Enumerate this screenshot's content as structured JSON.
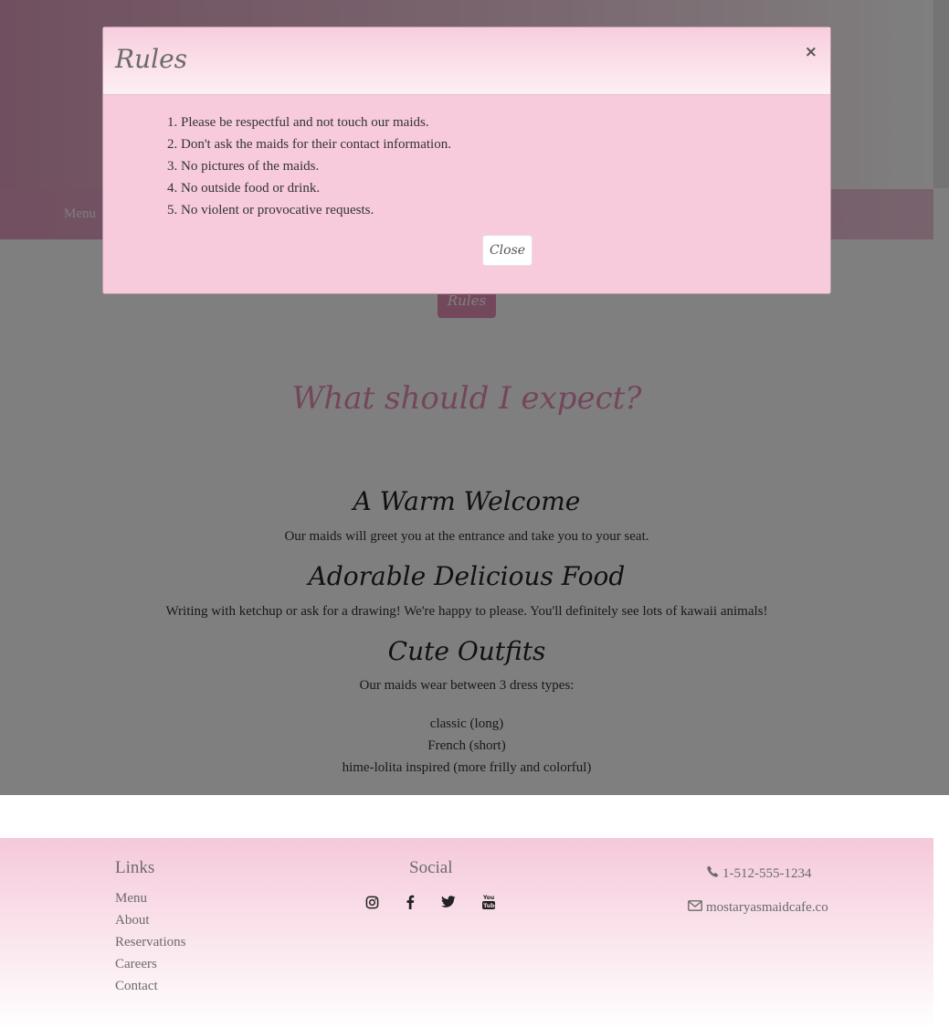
{
  "hero": {
    "nav_menu": "Menu"
  },
  "page": {
    "rules_button": "Rules",
    "section_title": "What should I expect?",
    "features": [
      {
        "heading": "A Warm Welcome",
        "text": "Our maids will greet you at the entrance and take you to your seat."
      },
      {
        "heading": "Adorable Delicious Food",
        "text": "Writing with ketchup or ask for a drawing! We're happy to please. You'll definitely see lots of kawaii animals!"
      },
      {
        "heading": "Cute Outfits",
        "text": "Our maids wear between 3 dress types:"
      }
    ],
    "dress_types": [
      "classic (long)",
      "French (short)",
      "hime-lolita inspired (more frilly and colorful)"
    ]
  },
  "modal": {
    "title": "Rules",
    "close_x": "×",
    "rules": [
      "1. Please be respectful and not touch our maids.",
      "2. Don't ask the maids for their contact information.",
      "3. No pictures of the maids.",
      "4. No outside food or drink.",
      "5. No violent or provocative requests."
    ],
    "close_button": "Close"
  },
  "footer": {
    "links_title": "Links",
    "links": [
      "Menu",
      "About",
      "Reservations",
      "Careers",
      "Contact"
    ],
    "social_title": "Social",
    "social_icons": [
      "instagram-icon",
      "facebook-icon",
      "twitter-icon",
      "youtube-icon"
    ],
    "phone": "1-512-555-1234",
    "email": "mostaryasmaidcafe.co"
  },
  "colors": {
    "accent_pink": "#e88db8",
    "modal_bg": "#f7cbdc",
    "footer_top": "#f5c9da"
  }
}
